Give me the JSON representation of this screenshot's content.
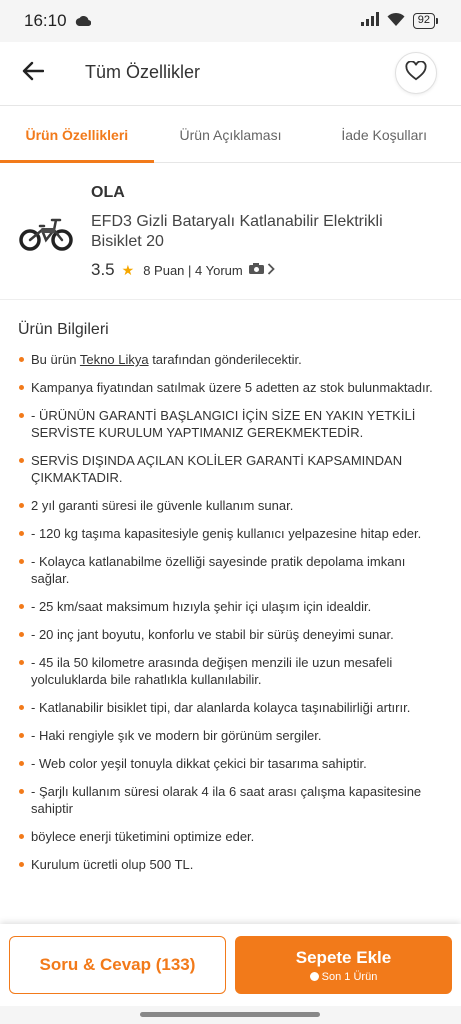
{
  "status_bar": {
    "time": "16:10",
    "battery": "92"
  },
  "header": {
    "title": "Tüm Özellikler"
  },
  "tabs": [
    {
      "label": "Ürün Özellikleri",
      "active": true
    },
    {
      "label": "Ürün Açıklaması",
      "active": false
    },
    {
      "label": "İade Koşulları",
      "active": false
    }
  ],
  "product": {
    "brand": "OLA",
    "name": "EFD3 Gizli Bataryalı Katlanabilir Elektrikli Bisiklet 20",
    "rating": "3.5",
    "reviews": "8 Puan | 4 Yorum"
  },
  "info": {
    "title": "Ürün Bilgileri",
    "seller_prefix": "Bu ürün ",
    "seller_name": "Tekno Likya",
    "seller_suffix": " tarafından gönderilecektir.",
    "items": [
      "Kampanya fiyatından satılmak üzere 5 adetten az stok bulunmaktadır.",
      "- ÜRÜNÜN GARANTİ BAŞLANGICI İÇİN SİZE EN YAKIN YETKİLİ SERVİSTE KURULUM YAPTIMANIZ GEREKMEKTEDİR.",
      "SERVİS DIŞINDA AÇILAN KOLİLER GARANTİ KAPSAMINDAN ÇIKMAKTADIR.",
      "2 yıl garanti süresi ile güvenle kullanım sunar.",
      "- 120 kg taşıma kapasitesiyle geniş kullanıcı yelpazesine hitap eder.",
      "- Kolayca katlanabilme özelliği sayesinde pratik depolama imkanı sağlar.",
      "- 25 km/saat maksimum hızıyla şehir içi ulaşım için idealdir.",
      "- 20 inç jant boyutu, konforlu ve stabil bir sürüş deneyimi sunar.",
      "- 45 ila 50 kilometre arasında değişen menzili ile uzun mesafeli yolculuklarda bile rahatlıkla kullanılabilir.",
      "- Katlanabilir bisiklet tipi, dar alanlarda kolayca taşınabilirliği artırır.",
      "- Haki rengiyle şık ve modern bir görünüm sergiler.",
      "- Web color yeşil tonuyla dikkat çekici bir tasarıma sahiptir.",
      "- Şarjlı kullanım süresi olarak 4 ila 6 saat arası çalışma kapasitesine sahiptir",
      "böylece enerji tüketimini optimize eder.",
      "Kurulum ücretli olup 500 TL."
    ]
  },
  "bottom": {
    "qa_label": "Soru & Cevap (133)",
    "cart_label": "Sepete Ekle",
    "cart_sub": "Son 1 Ürün"
  },
  "colors": {
    "accent": "#f27a1a",
    "star": "#f6a700"
  },
  "icons": [
    "cloud-icon",
    "signal-icon",
    "wifi-icon",
    "battery-icon",
    "back-arrow-icon",
    "heart-icon",
    "star-icon",
    "camera-icon",
    "chevron-right-icon",
    "clock-icon"
  ]
}
